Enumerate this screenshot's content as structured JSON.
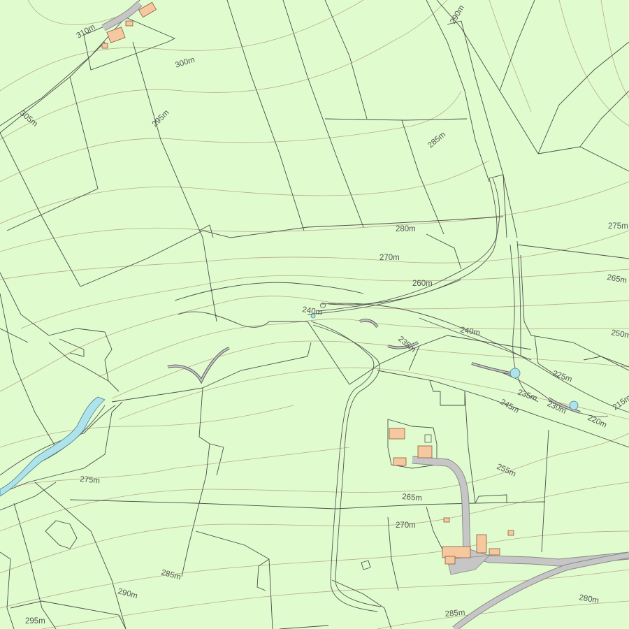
{
  "map": {
    "colors": {
      "land": "#e0fcce",
      "contour": "#b59a80",
      "boundary": "#4d4d4d",
      "water": "#aee3ec",
      "building": "#f5c8a0",
      "road": "#c6c6c6"
    },
    "contour_labels": [
      "310m",
      "300m",
      "305m",
      "295m",
      "290m",
      "285m",
      "280m",
      "270m",
      "260m",
      "240m",
      "240m",
      "235m",
      "275m",
      "265m",
      "250m",
      "225m",
      "235m",
      "245m",
      "230m",
      "220m",
      "215m",
      "255m",
      "265m",
      "270m",
      "275m",
      "285m",
      "290m",
      "295m",
      "280m",
      "285m"
    ]
  }
}
